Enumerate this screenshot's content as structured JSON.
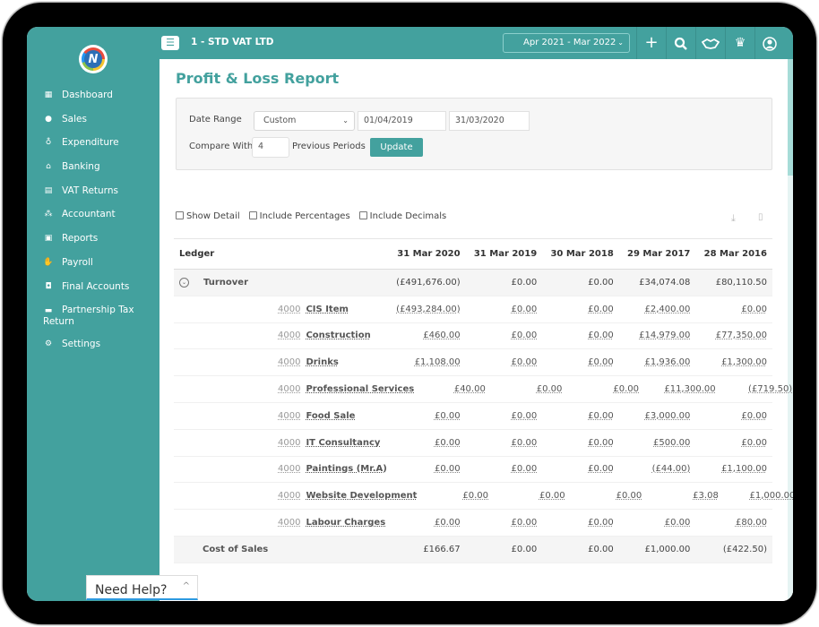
{
  "app": {
    "company": "1 - STD VAT LTD",
    "logo_letter": "N"
  },
  "sidebar": {
    "items": [
      {
        "label": "Dashboard",
        "icon": "dashboard-icon"
      },
      {
        "label": "Sales",
        "icon": "sales-icon"
      },
      {
        "label": "Expenditure",
        "icon": "money-bag-icon"
      },
      {
        "label": "Banking",
        "icon": "bank-icon"
      },
      {
        "label": "VAT Returns",
        "icon": "vat-icon"
      },
      {
        "label": "Accountant",
        "icon": "org-chart-icon"
      },
      {
        "label": "Reports",
        "icon": "clipboard-icon"
      },
      {
        "label": "Payroll",
        "icon": "payroll-icon"
      },
      {
        "label": "Final Accounts",
        "icon": "final-accounts-icon"
      },
      {
        "label": "Partnership Tax Return",
        "icon": "folder-icon"
      },
      {
        "label": "Settings",
        "icon": "gear-icon"
      }
    ]
  },
  "topbar": {
    "period": "Apr 2021 - Mar 2022",
    "icons": [
      "plus-icon",
      "search-icon",
      "handshake-icon",
      "hmrc-crest-icon",
      "user-icon"
    ]
  },
  "page": {
    "title": "Profit & Loss Report"
  },
  "filters": {
    "date_range_label": "Date Range",
    "date_range_value": "Custom",
    "from": "01/04/2019",
    "to": "31/03/2020",
    "compare_label": "Compare With",
    "compare_value": "4",
    "previous_periods_label": "Previous Periods",
    "update_label": "Update"
  },
  "options": {
    "show_detail": "Show Detail",
    "include_percentages": "Include Percentages",
    "include_decimals": "Include Decimals"
  },
  "table": {
    "headers": [
      "Ledger",
      "31 Mar 2020",
      "31 Mar 2019",
      "30 Mar 2018",
      "29 Mar 2017",
      "28 Mar 2016"
    ],
    "turnover": {
      "label": "Turnover",
      "values": [
        "(£491,676.00)",
        "£0.00",
        "£0.00",
        "£34,074.08",
        "£80,110.50"
      ]
    },
    "rows": [
      {
        "code": "4000",
        "name": "CIS Item",
        "values": [
          "(£493,284.00)",
          "£0.00",
          "£0.00",
          "£2,400.00",
          "£0.00"
        ]
      },
      {
        "code": "4000",
        "name": "Construction",
        "values": [
          "£460.00",
          "£0.00",
          "£0.00",
          "£14,979.00",
          "£77,350.00"
        ]
      },
      {
        "code": "4000",
        "name": "Drinks",
        "values": [
          "£1,108.00",
          "£0.00",
          "£0.00",
          "£1,936.00",
          "£1,300.00"
        ]
      },
      {
        "code": "4000",
        "name": "Professional Services",
        "values": [
          "£40.00",
          "£0.00",
          "£0.00",
          "£11,300.00",
          "(£719.50)"
        ]
      },
      {
        "code": "4000",
        "name": "Food Sale",
        "values": [
          "£0.00",
          "£0.00",
          "£0.00",
          "£3,000.00",
          "£0.00"
        ]
      },
      {
        "code": "4000",
        "name": "IT Consultancy",
        "values": [
          "£0.00",
          "£0.00",
          "£0.00",
          "£500.00",
          "£0.00"
        ]
      },
      {
        "code": "4000",
        "name": "Paintings (Mr.A)",
        "values": [
          "£0.00",
          "£0.00",
          "£0.00",
          "(£44.00)",
          "£1,100.00"
        ]
      },
      {
        "code": "4000",
        "name": "Website Development",
        "values": [
          "£0.00",
          "£0.00",
          "£0.00",
          "£3.08",
          "£1,000.00"
        ]
      },
      {
        "code": "4000",
        "name": "Labour Charges",
        "values": [
          "£0.00",
          "£0.00",
          "£0.00",
          "£0.00",
          "£80.00"
        ]
      }
    ],
    "cost_of_sales": {
      "label": "Cost of Sales",
      "values": [
        "£166.67",
        "£0.00",
        "£0.00",
        "£1,000.00",
        "(£422.50)"
      ]
    }
  },
  "help": {
    "label": "Need Help?"
  },
  "colors": {
    "brand": "#43a19e"
  }
}
